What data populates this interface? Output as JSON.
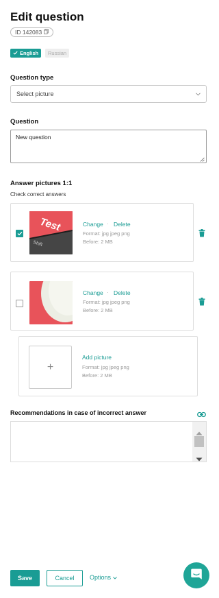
{
  "header": {
    "title": "Edit question",
    "id_label": "ID 142083"
  },
  "languages": {
    "active": "English",
    "inactive": "Russian"
  },
  "question_type": {
    "label": "Question type",
    "value": "Select picture"
  },
  "question": {
    "label": "Question",
    "value": "New question"
  },
  "answers": {
    "title": "Answer pictures 1:1",
    "subtitle": "Check correct answers",
    "items": [
      {
        "checked": true,
        "change": "Change",
        "delete": "Delete",
        "format": "Format: jpg  jpeg  png",
        "before": "Before: 2 MB",
        "image_text": "Test",
        "image_subtext": "Shift"
      },
      {
        "checked": false,
        "change": "Change",
        "delete": "Delete",
        "format": "Format: jpg  jpeg  png",
        "before": "Before: 2 MB"
      }
    ],
    "add": {
      "label": "Add picture",
      "format": "Format: jpg  jpeg  png",
      "before": "Before: 2 MB"
    }
  },
  "recommendations": {
    "label": "Recommendations in case of incorrect answer",
    "value": ""
  },
  "footer": {
    "save": "Save",
    "cancel": "Cancel",
    "options": "Options"
  },
  "colors": {
    "accent": "#1a9c94",
    "image_red": "#e8535a"
  },
  "icons": [
    "copy-icon",
    "check-icon",
    "chevron-down-icon",
    "trash-icon",
    "link-icon",
    "chat-icon",
    "plus-icon"
  ]
}
